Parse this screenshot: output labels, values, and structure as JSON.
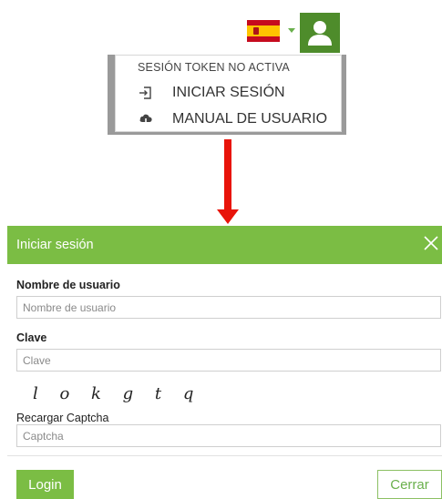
{
  "header": {
    "language_flag_icon": "spain-flag-icon",
    "user_icon": "user-icon",
    "accent_color": "#4e8c2b"
  },
  "dropdown": {
    "status_text": "SESIÓN TOKEN NO ACTIVA",
    "items": [
      {
        "label": "INICIAR SESIÓN",
        "icon": "sign-in-icon"
      },
      {
        "label": "MANUAL DE USUARIO",
        "icon": "cloud-download-icon"
      }
    ]
  },
  "arrow": {
    "color": "#e8140a"
  },
  "modal": {
    "title": "Iniciar sesión",
    "header_color": "#7bbd44",
    "username": {
      "label": "Nombre de usuario",
      "placeholder": "Nombre de usuario",
      "value": ""
    },
    "password": {
      "label": "Clave",
      "placeholder": "Clave",
      "value": ""
    },
    "captcha": {
      "text": "l o k g t q",
      "reload_label": "Recargar Captcha",
      "placeholder": "Captcha",
      "value": ""
    },
    "login_label": "Login",
    "close_label": "Cerrar"
  }
}
